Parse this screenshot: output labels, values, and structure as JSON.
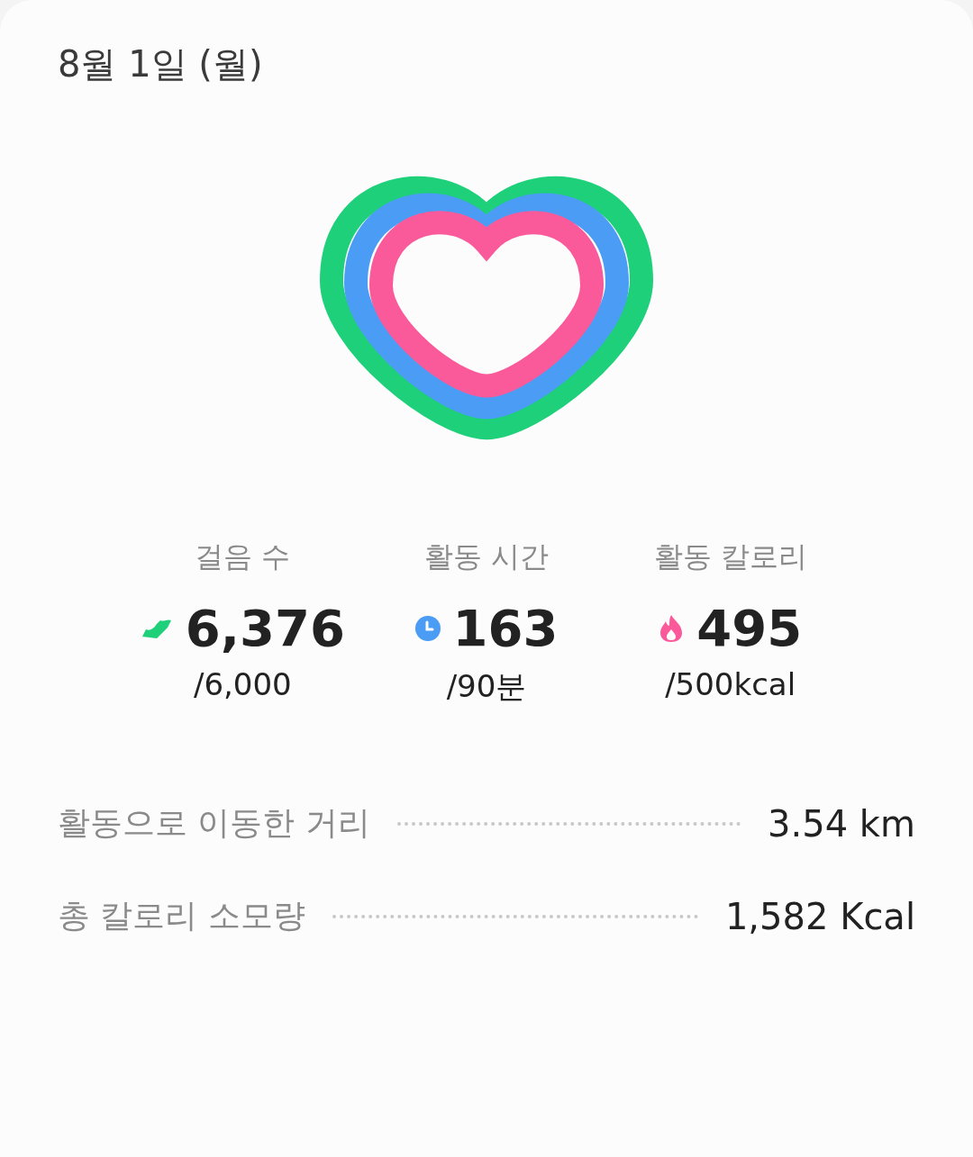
{
  "date": "8월 1일 (월)",
  "stats": [
    {
      "kind": "steps",
      "label": "걸음 수",
      "value": "6,376",
      "goal": "/6,000",
      "color": "#1ed07a"
    },
    {
      "kind": "time",
      "label": "활동 시간",
      "value": "163",
      "goal": "/90분",
      "color": "#4b9cf5"
    },
    {
      "kind": "calories",
      "label": "활동 칼로리",
      "value": "495",
      "goal": "/500kcal",
      "color": "#fa5a9a"
    }
  ],
  "details": [
    {
      "label": "활동으로 이동한 거리",
      "value": "3.54 km"
    },
    {
      "label": "총 칼로리 소모량",
      "value": "1,582 Kcal"
    }
  ]
}
